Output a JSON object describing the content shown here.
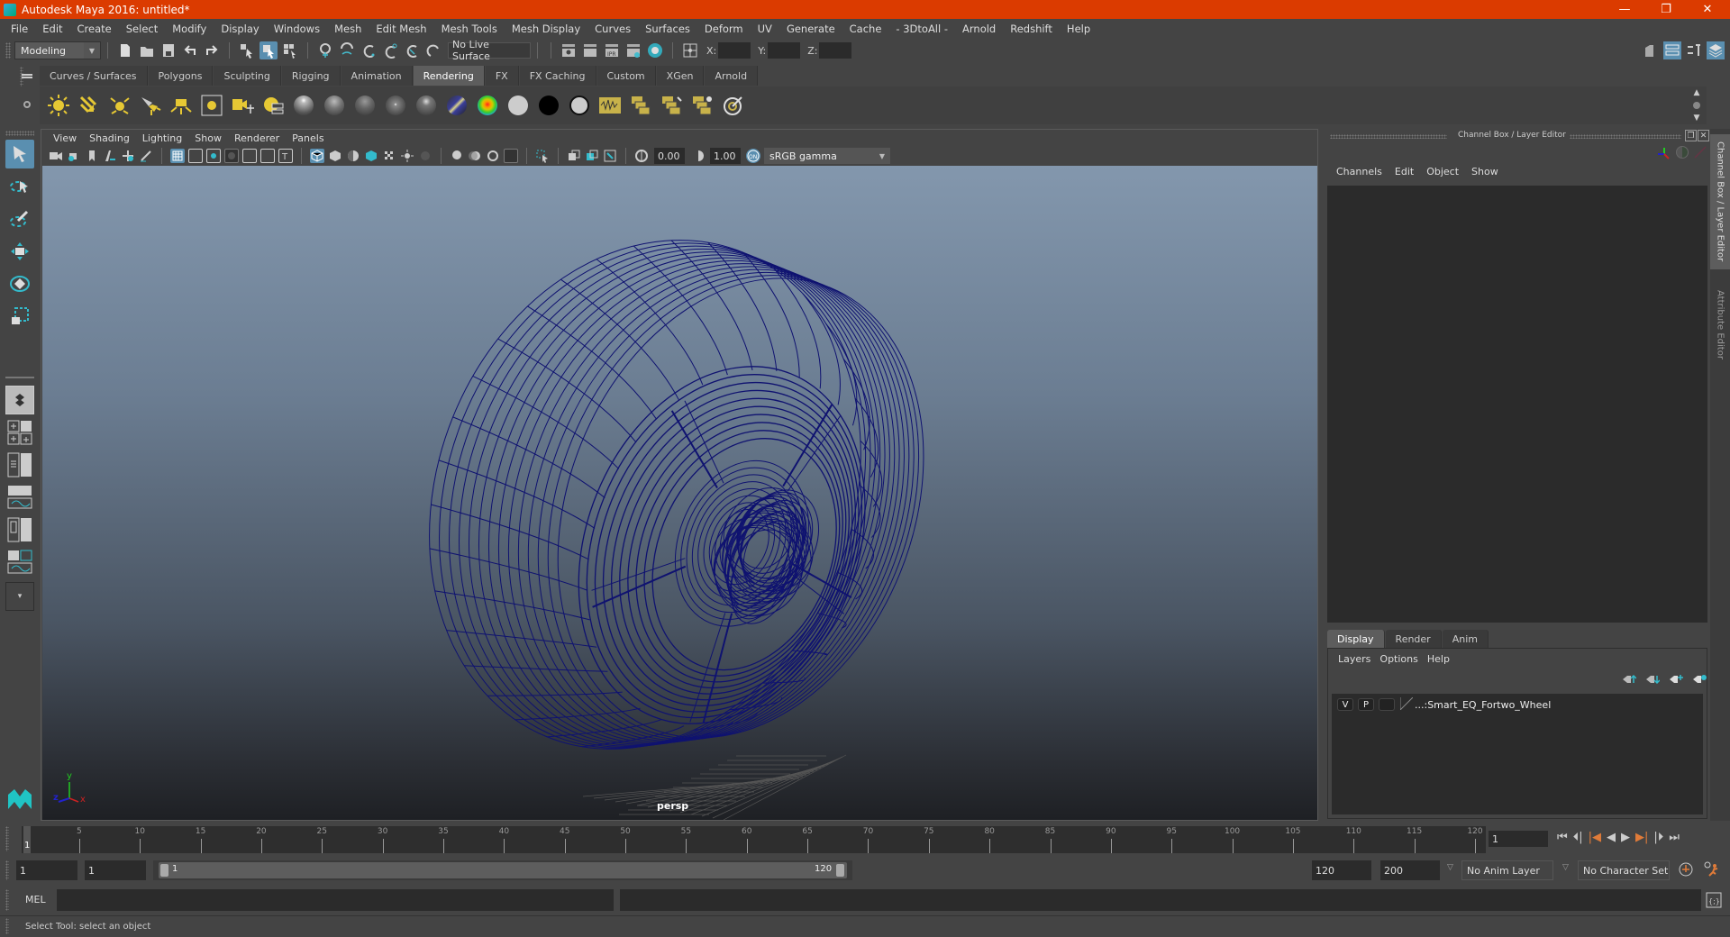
{
  "window": {
    "title": "Autodesk Maya 2016: untitled*",
    "controls": {
      "minimize": "—",
      "restore": "❐",
      "close": "✕"
    }
  },
  "menubar": [
    "File",
    "Edit",
    "Create",
    "Select",
    "Modify",
    "Display",
    "Windows",
    "Mesh",
    "Edit Mesh",
    "Mesh Tools",
    "Mesh Display",
    "Curves",
    "Surfaces",
    "Deform",
    "UV",
    "Generate",
    "Cache",
    "- 3DtoAll -",
    "Arnold",
    "Redshift",
    "Help"
  ],
  "statusline": {
    "menuset": "Modeling",
    "live_surface": "No Live Surface",
    "x_label": "X:",
    "y_label": "Y:",
    "z_label": "Z:",
    "x_value": "",
    "y_value": "",
    "z_value": ""
  },
  "shelf": {
    "tabs": [
      "Curves / Surfaces",
      "Polygons",
      "Sculpting",
      "Rigging",
      "Animation",
      "Rendering",
      "FX",
      "FX Caching",
      "Custom",
      "XGen",
      "Arnold"
    ],
    "active_tab": "Rendering",
    "icons": [
      "ambient-light-icon",
      "directional-light-icon",
      "point-light-icon",
      "spot-light-icon",
      "area-light-icon",
      "volume-light-icon",
      "camera-aim-icon",
      "create-camera-icon",
      "blinn-sphere-icon",
      "lambert-sphere-icon",
      "phong-sphere-icon",
      "phonge-sphere-icon",
      "anisotropic-sphere-icon",
      "ramp-shader-icon",
      "rainbow-shader-icon",
      "surface-shader-white-icon",
      "surface-shader-black-icon",
      "use-background-icon",
      "hypershade-icon",
      "render-layer-icon",
      "render-view-icon",
      "ipr-render-icon",
      "render-settings-icon"
    ]
  },
  "viewport": {
    "menu": [
      "View",
      "Shading",
      "Lighting",
      "Show",
      "Renderer",
      "Panels"
    ],
    "exposure": "0.00",
    "gamma": "1.00",
    "color_space": "sRGB gamma",
    "camera_label": "persp",
    "axis": {
      "x": "x",
      "y": "y",
      "z": "z"
    },
    "wire_color": "#0f1270"
  },
  "channel_box": {
    "title": "Channel Box / Layer Editor",
    "menu": [
      "Channels",
      "Edit",
      "Object",
      "Show"
    ]
  },
  "layer_editor": {
    "tabs": [
      "Display",
      "Render",
      "Anim"
    ],
    "active_tab": "Display",
    "menu": [
      "Layers",
      "Options",
      "Help"
    ],
    "layers": [
      {
        "visible": "V",
        "playback": "P",
        "name": "...:Smart_EQ_Fortwo_Wheel"
      }
    ]
  },
  "side_tabs": [
    "Channel Box / Layer Editor",
    "Attribute Editor"
  ],
  "timeline": {
    "ticks": [
      "5",
      "10",
      "15",
      "20",
      "25",
      "30",
      "35",
      "40",
      "45",
      "50",
      "55",
      "60",
      "65",
      "70",
      "75",
      "80",
      "85",
      "90",
      "95",
      "100",
      "105",
      "110",
      "115",
      "120"
    ],
    "current_frame_marker": "1",
    "current_frame": "1",
    "range_min": 1,
    "range_max": 120
  },
  "range": {
    "start_field": "1",
    "playback_start": "1",
    "slider_start": "1",
    "slider_end": "120",
    "playback_end": "120",
    "end_field": "200",
    "anim_layer": "No Anim Layer",
    "character_set": "No Character Set"
  },
  "mel": {
    "label": "MEL",
    "value": ""
  },
  "status": {
    "help_text": "Select Tool: select an object"
  },
  "colors": {
    "title_bar": "#db3b00",
    "accent": "#5a8fb0",
    "playhead": "#e07b39"
  }
}
